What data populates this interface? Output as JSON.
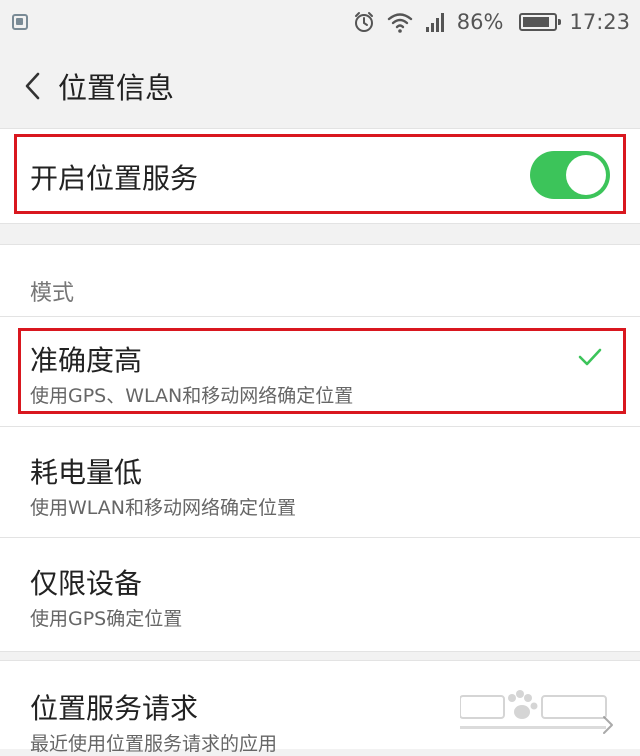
{
  "status_bar": {
    "battery_percent": "86%",
    "battery_level": 0.86,
    "time": "17:23",
    "icons": [
      "app-notification-icon",
      "alarm-icon",
      "wifi-icon",
      "signal-icon",
      "battery-icon"
    ]
  },
  "header": {
    "title": "位置信息",
    "back_icon": "chevron-left-icon"
  },
  "location_service": {
    "label": "开启位置服务",
    "enabled": true
  },
  "mode": {
    "header": "模式",
    "options": [
      {
        "title": "准确度高",
        "subtitle": "使用GPS、WLAN和移动网络确定位置",
        "selected": true
      },
      {
        "title": "耗电量低",
        "subtitle": "使用WLAN和移动网络确定位置",
        "selected": false
      },
      {
        "title": "仅限设备",
        "subtitle": "使用GPS确定位置",
        "selected": false
      }
    ]
  },
  "requests": {
    "title": "位置服务请求",
    "subtitle": "最近使用位置服务请求的应用"
  },
  "colors": {
    "accent": "#3cc45a",
    "highlight": "#d9171f",
    "background": "#f2f2f2"
  }
}
